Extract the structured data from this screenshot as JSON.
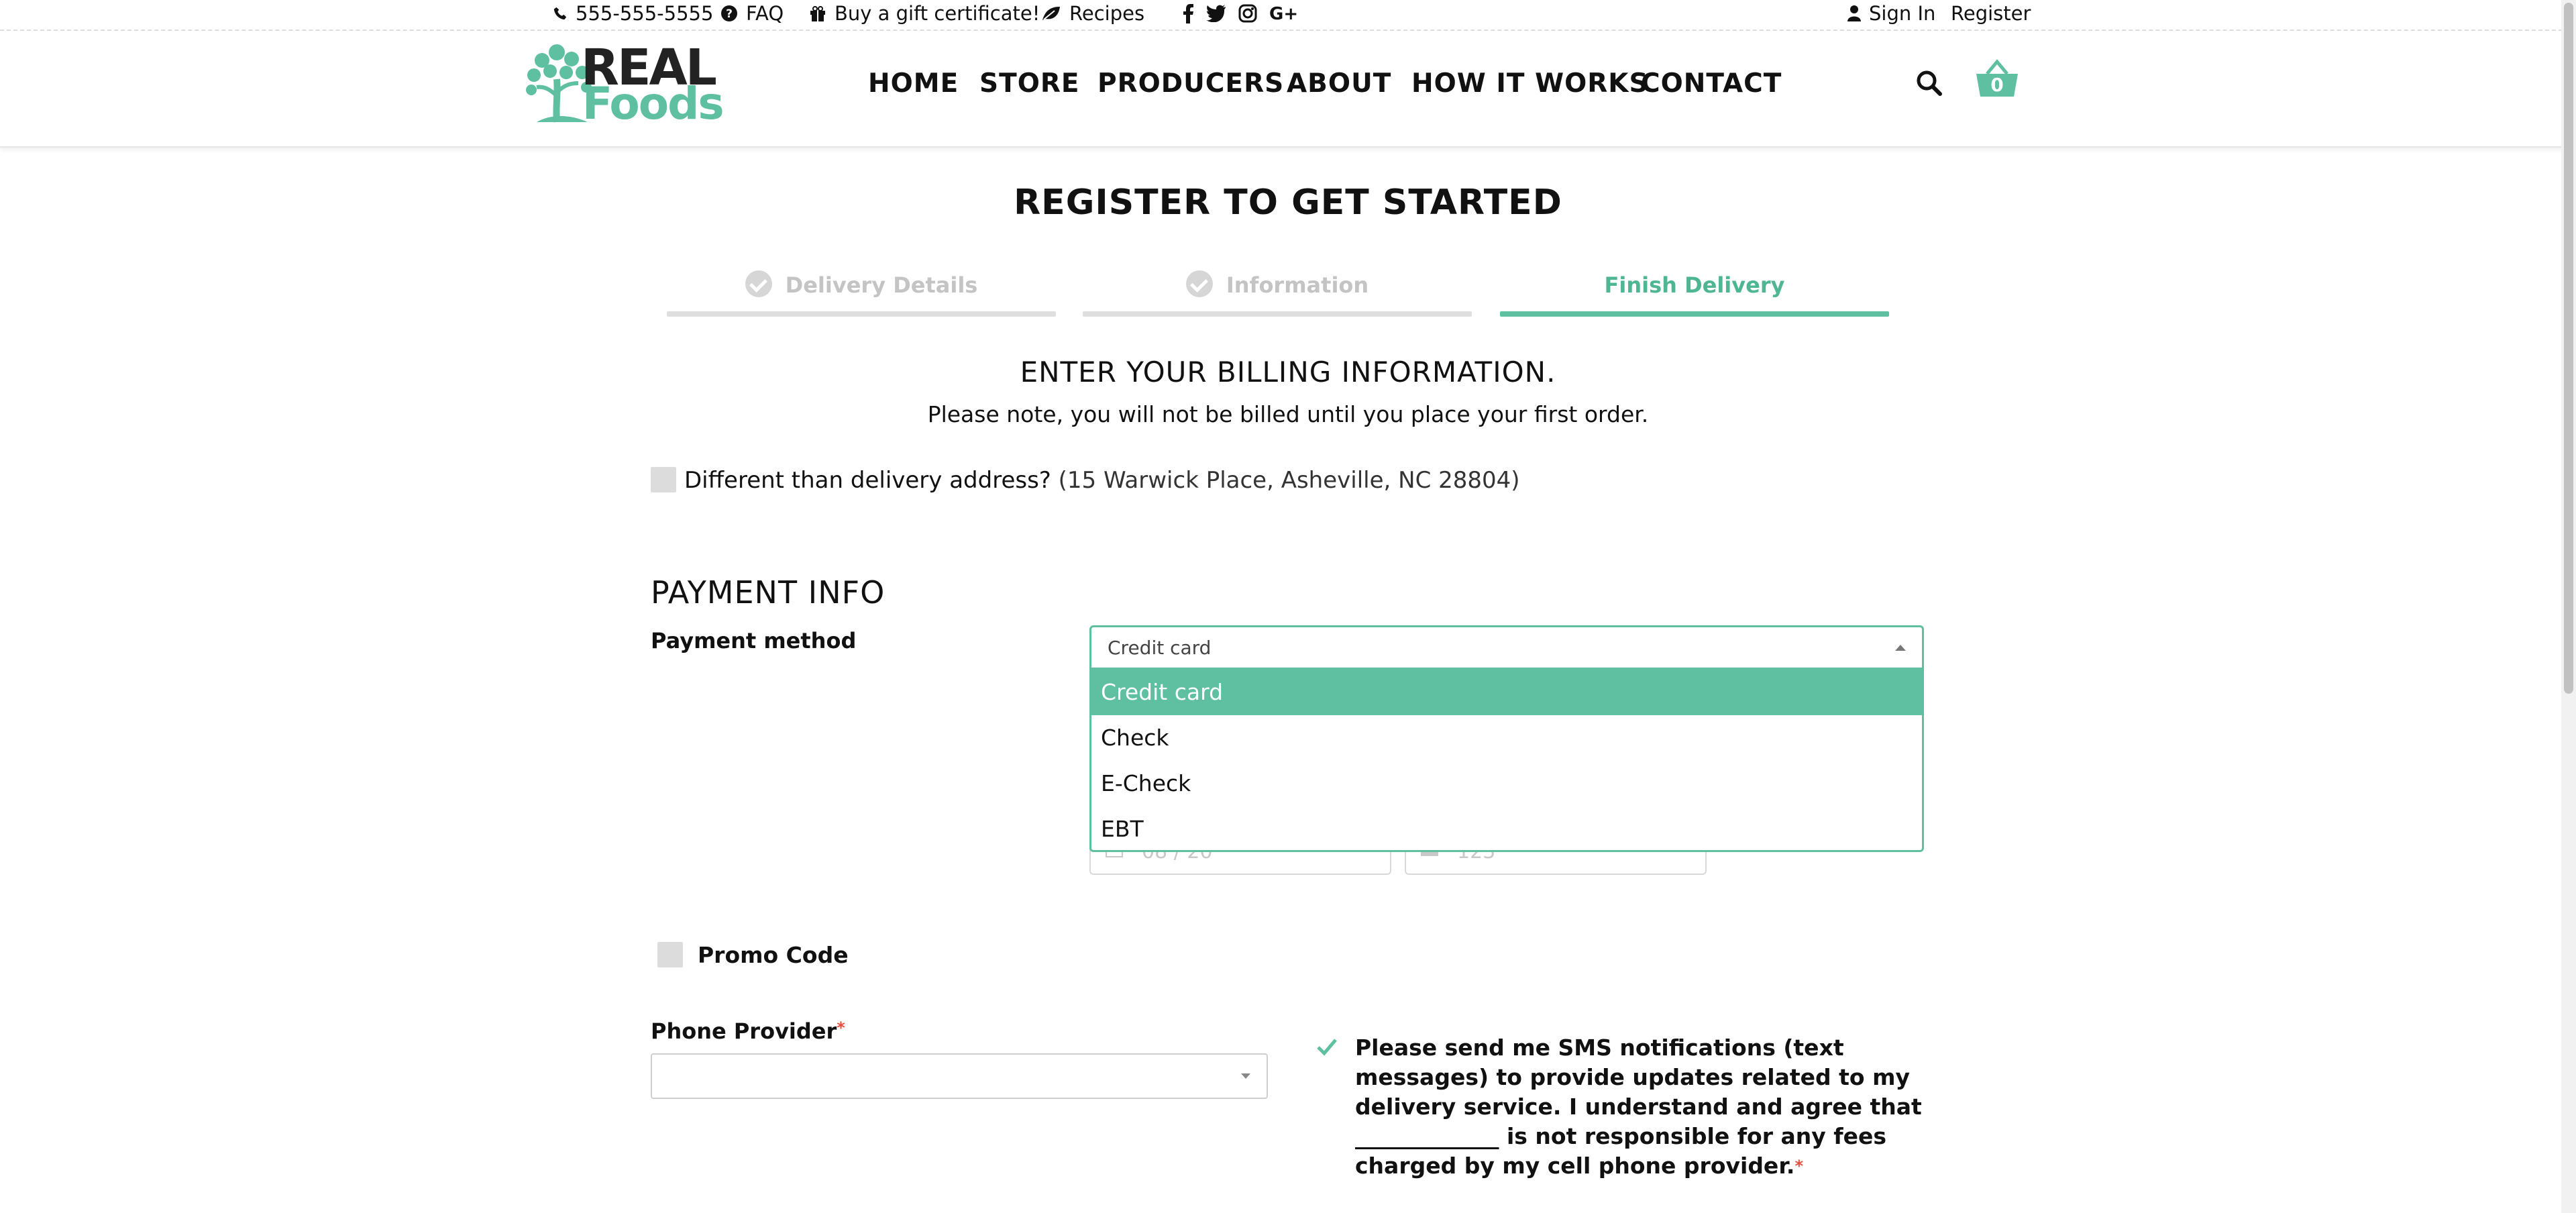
{
  "topbar": {
    "phone": "555-555-5555",
    "faq": "FAQ",
    "gift": "Buy a gift certificate!",
    "recipes": "Recipes",
    "signin": "Sign In",
    "register": "Register",
    "social_icons": [
      "facebook-icon",
      "twitter-icon",
      "instagram-icon",
      "google-plus-icon"
    ]
  },
  "header": {
    "logo_top": "REAL",
    "logo_bottom": "Foods",
    "nav": [
      "HOME",
      "STORE",
      "PRODUCERS",
      "ABOUT",
      "HOW IT WORKS",
      "CONTACT"
    ],
    "cart_count": "0"
  },
  "page": {
    "title": "REGISTER TO GET STARTED",
    "steps": [
      "Delivery Details",
      "Information",
      "Finish Delivery"
    ],
    "active_step": 2,
    "billing_title": "ENTER YOUR BILLING INFORMATION.",
    "billing_note": "Please note, you will not be billed until you place your first order.",
    "diff_address_label": "Different than delivery address?",
    "diff_address_value": "(15 Warwick Place, Asheville, NC 28804)",
    "payment_title": "PAYMENT INFO",
    "payment_method_label": "Payment method",
    "payment_method_value": "Credit card",
    "payment_options": [
      "Credit card",
      "Check",
      "E-Check",
      "EBT"
    ],
    "expiry_placeholder": "08 / 20",
    "cvc_placeholder": "123",
    "promo_label": "Promo Code",
    "phone_provider_label": "Phone Provider",
    "phone_provider_value": "",
    "sms_text": "Please send me SMS notifications (text messages) to provide updates related to my delivery service. I understand and agree that _____________ is not responsible for any fees charged by my cell phone provider."
  },
  "colors": {
    "accent": "#5ebfa1",
    "required": "#e74c3c"
  }
}
